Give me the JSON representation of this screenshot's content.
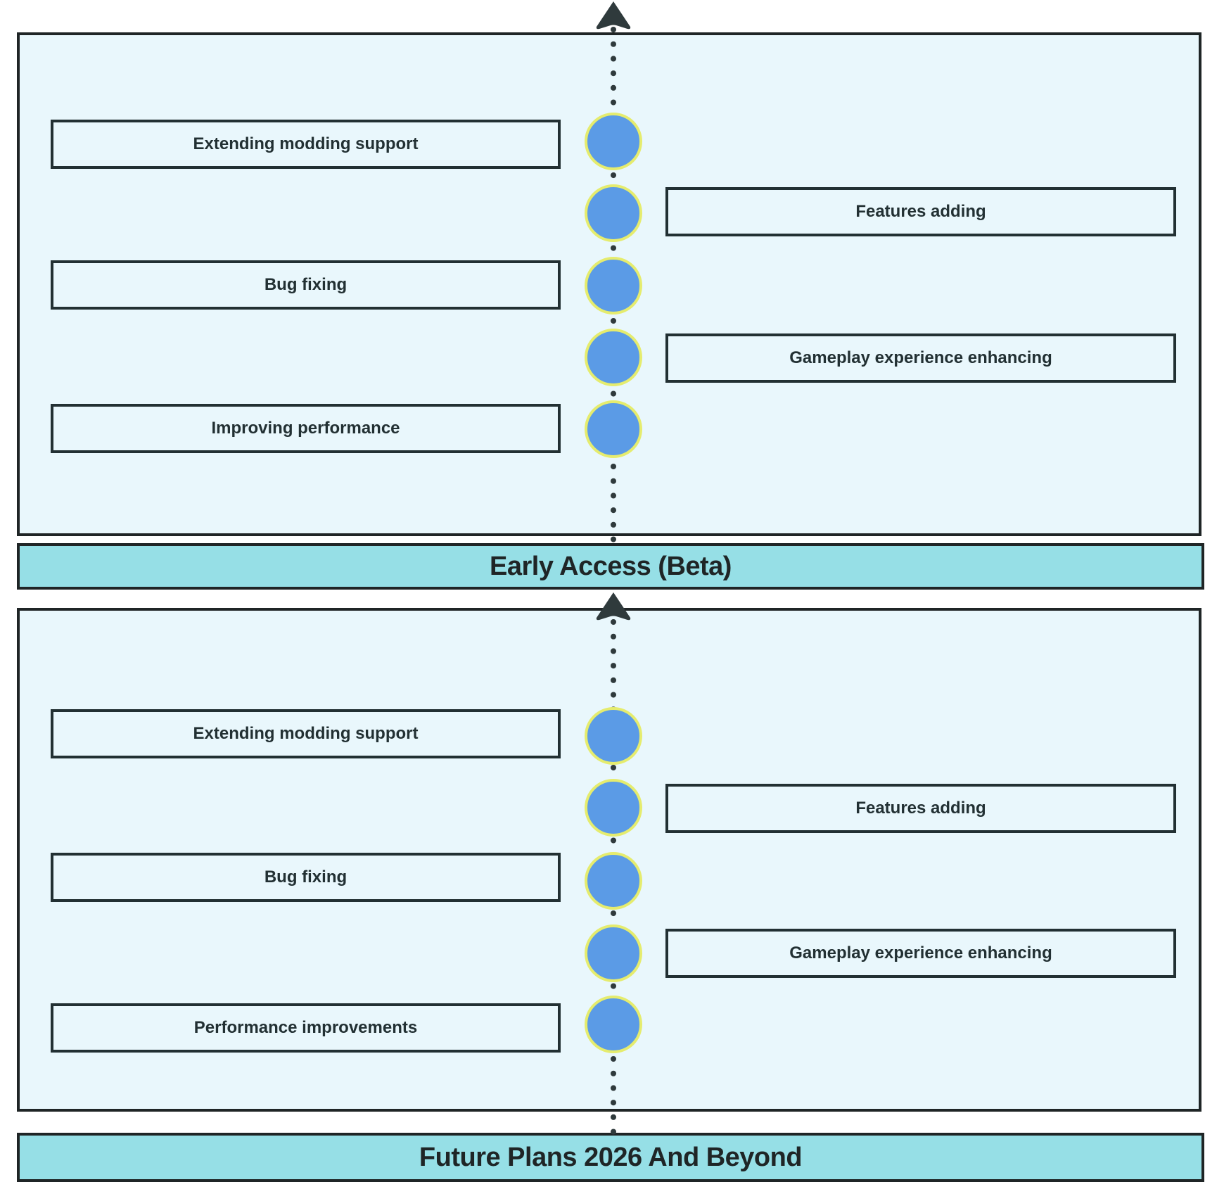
{
  "colors": {
    "frame_fill": "#e9f7fc",
    "banner_fill": "#96dfe6",
    "stroke": "#1f2526",
    "node_fill": "#5b9be6",
    "node_ring": "#e5ec6e",
    "connector": "#2f3a3c"
  },
  "sections": [
    {
      "items": [
        {
          "label": "Extending modding support",
          "side": "left"
        },
        {
          "label": "Features adding",
          "side": "right"
        },
        {
          "label": "Bug fixing",
          "side": "left"
        },
        {
          "label": "Gameplay experience enhancing",
          "side": "right"
        },
        {
          "label": "Improving performance",
          "side": "left"
        }
      ],
      "banner": "Early Access (Beta)"
    },
    {
      "items": [
        {
          "label": "Extending modding support",
          "side": "left"
        },
        {
          "label": "Features adding",
          "side": "right"
        },
        {
          "label": "Bug fixing",
          "side": "left"
        },
        {
          "label": "Gameplay experience enhancing",
          "side": "right"
        },
        {
          "label": "Performance improvements",
          "side": "left"
        }
      ],
      "banner": "Future Plans  2026 And Beyond"
    }
  ]
}
